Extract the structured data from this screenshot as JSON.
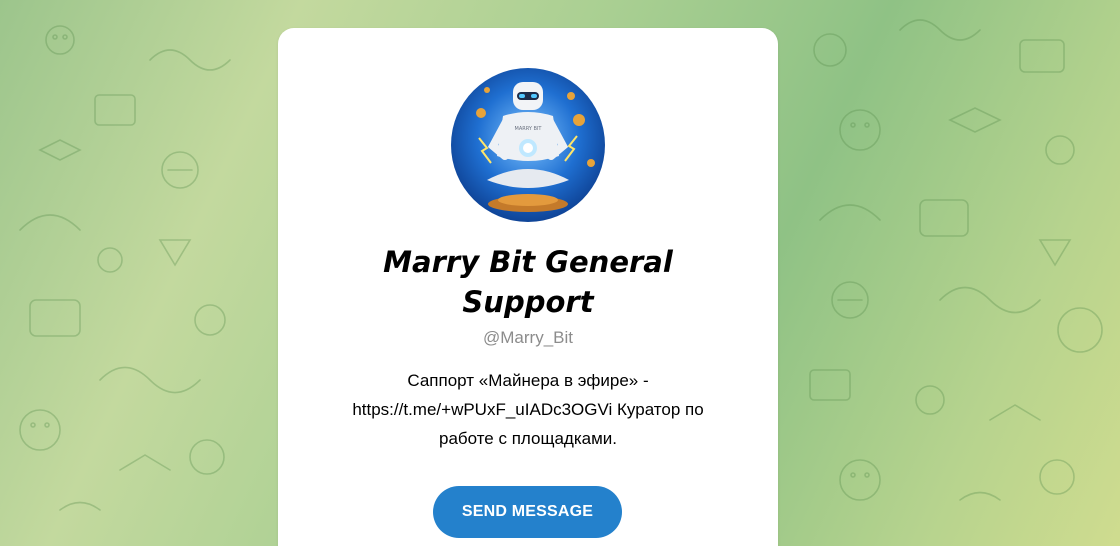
{
  "profile": {
    "name": "Marry Bit General Support",
    "username": "@Marry_Bit",
    "description": "Саппорт «Майнера в эфире» -\nhttps://t.me/+wPUxF_uIADc3OGVi Куратор по\nработе с площадками.",
    "avatar_icon": "robot-avatar-icon",
    "avatar_logo_text": "MARRY BIT"
  },
  "actions": {
    "send_label": "SEND MESSAGE"
  },
  "colors": {
    "button": "#2481cc",
    "card": "#ffffff",
    "background": "#a9cf92"
  }
}
